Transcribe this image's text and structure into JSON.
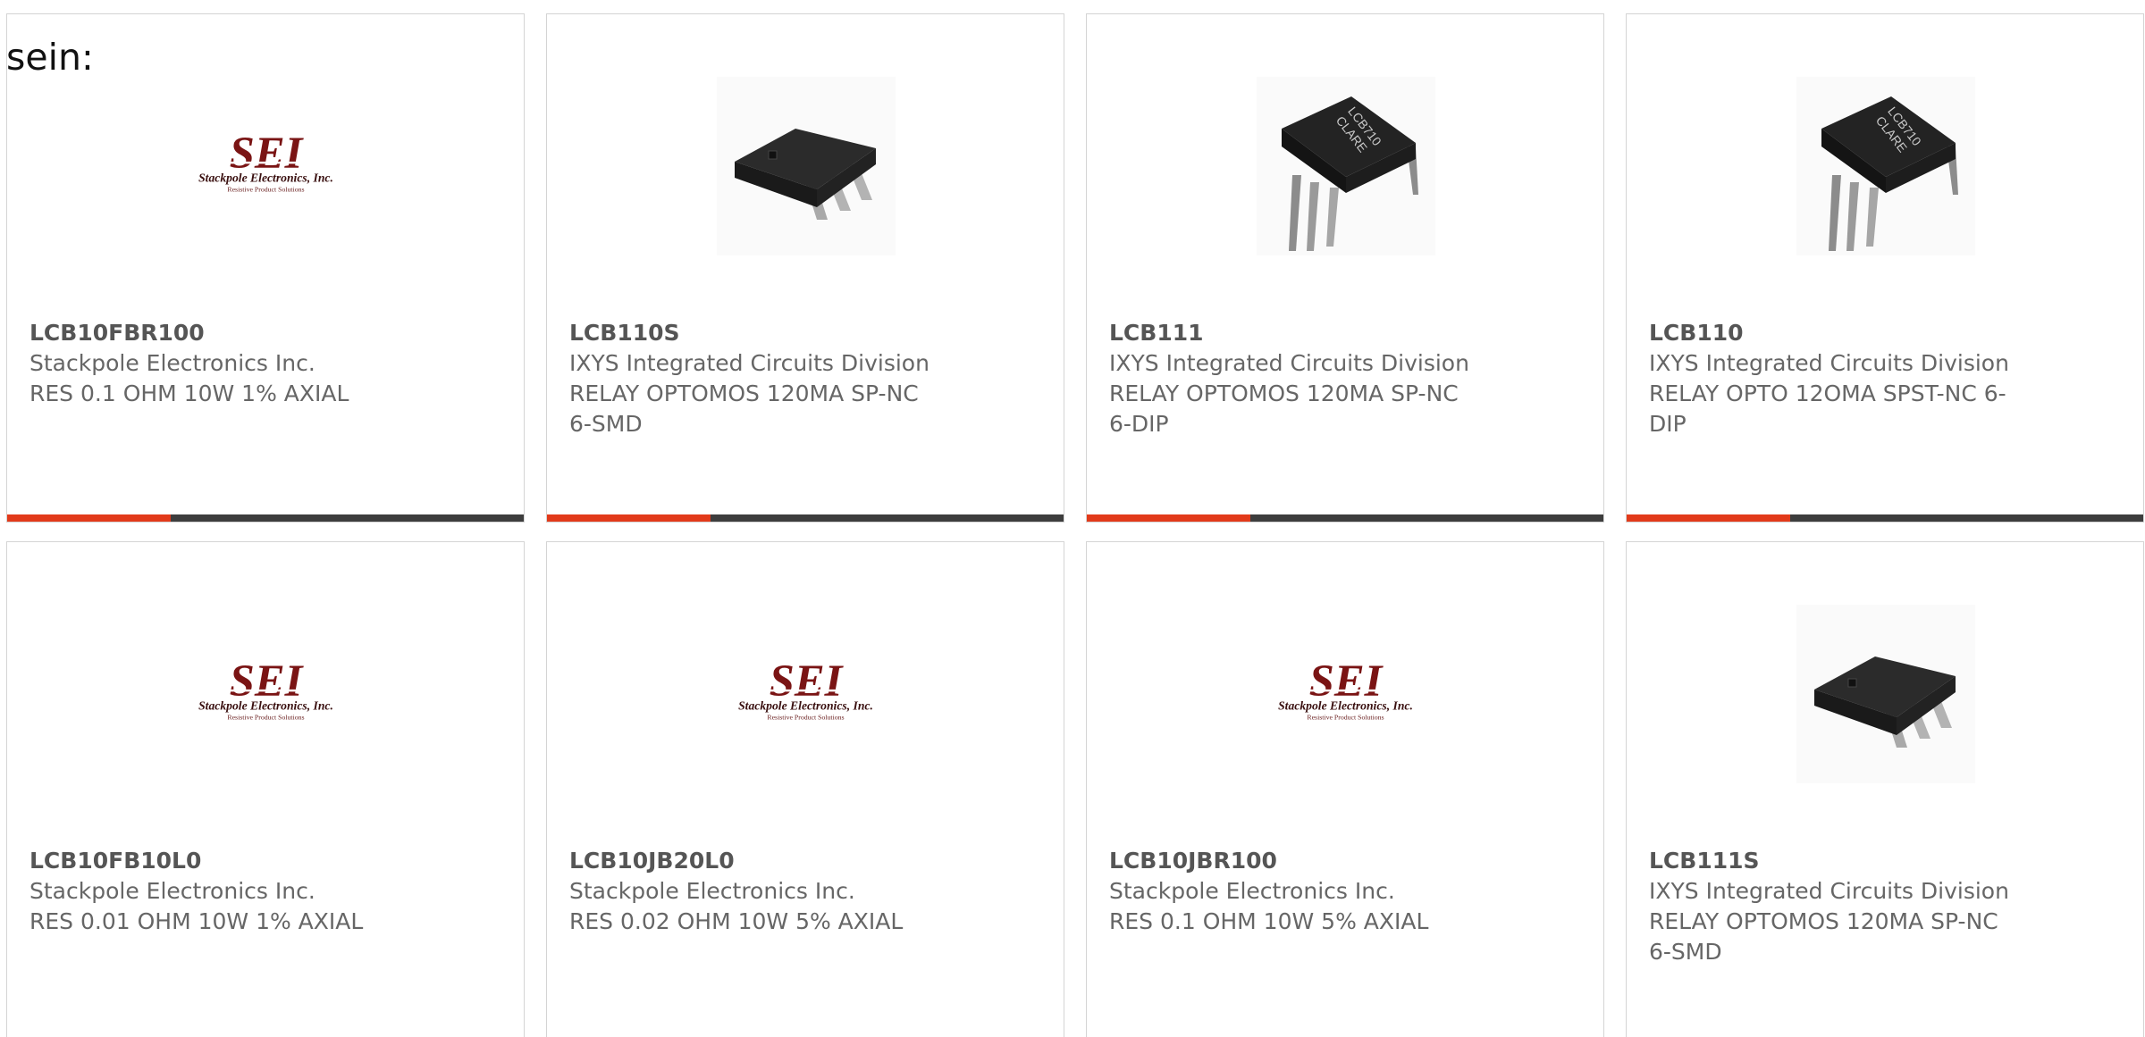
{
  "intro_text": "sein:",
  "colors": {
    "accent": "#e23a1a",
    "bar": "#3d3d3d",
    "border": "#d4d4d4",
    "text": "#666666"
  },
  "products": [
    {
      "part": "LCB10FBR100",
      "maker": "Stackpole Electronics Inc.",
      "desc": "RES 0.1 OHM 10W 1% AXIAL",
      "image": "sei-logo",
      "logo": {
        "brand": "SEI",
        "name": "Stackpole Electronics, Inc.",
        "tagline": "Resistive Product Solutions"
      }
    },
    {
      "part": "LCB110S",
      "maker": "IXYS Integrated Circuits Division",
      "desc": "RELAY OPTOMOS 120MA SP-NC 6-SMD",
      "image": "smd-chip"
    },
    {
      "part": "LCB111",
      "maker": "IXYS Integrated Circuits Division",
      "desc": "RELAY OPTOMOS 120MA SP-NC 6-DIP",
      "image": "dip-chip",
      "chip_marking": [
        "LCB710",
        "CLARE"
      ]
    },
    {
      "part": "LCB110",
      "maker": "IXYS Integrated Circuits Division",
      "desc": "RELAY OPTO 12OMA SPST-NC 6-DIP",
      "image": "dip-chip",
      "chip_marking": [
        "LCB710",
        "CLARE"
      ]
    },
    {
      "part": "LCB10FB10L0",
      "maker": "Stackpole Electronics Inc.",
      "desc": "RES 0.01 OHM 10W 1% AXIAL",
      "image": "sei-logo",
      "logo": {
        "brand": "SEI",
        "name": "Stackpole Electronics, Inc.",
        "tagline": "Resistive Product Solutions"
      }
    },
    {
      "part": "LCB10JB20L0",
      "maker": "Stackpole Electronics Inc.",
      "desc": "RES 0.02 OHM 10W 5% AXIAL",
      "image": "sei-logo",
      "logo": {
        "brand": "SEI",
        "name": "Stackpole Electronics, Inc.",
        "tagline": "Resistive Product Solutions"
      }
    },
    {
      "part": "LCB10JBR100",
      "maker": "Stackpole Electronics Inc.",
      "desc": "RES 0.1 OHM 10W 5% AXIAL",
      "image": "sei-logo",
      "logo": {
        "brand": "SEI",
        "name": "Stackpole Electronics, Inc.",
        "tagline": "Resistive Product Solutions"
      }
    },
    {
      "part": "LCB111S",
      "maker": "IXYS Integrated Circuits Division",
      "desc": "RELAY OPTOMOS 120MA SP-NC 6-SMD",
      "image": "smd-chip"
    }
  ]
}
